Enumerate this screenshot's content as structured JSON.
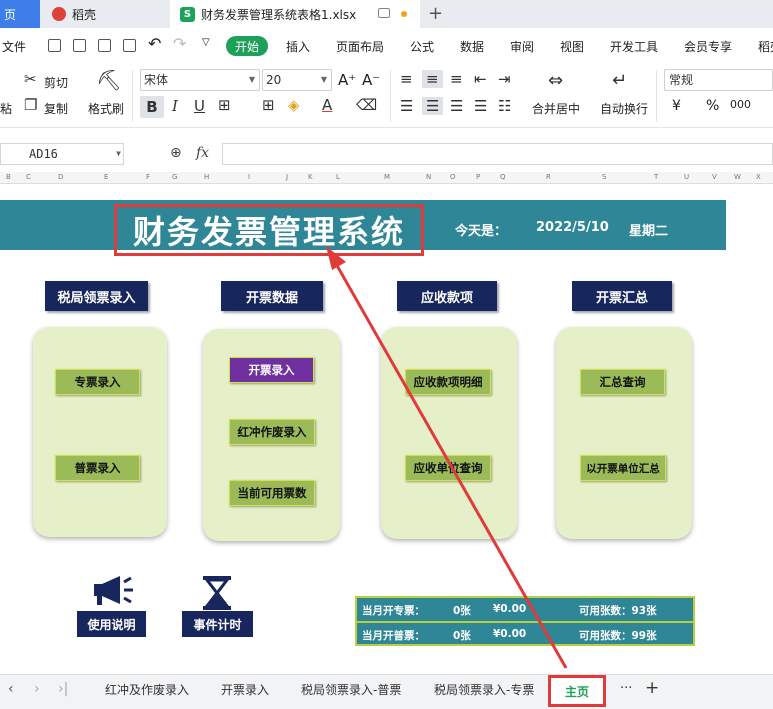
{
  "tabs": {
    "home": "页",
    "daoke": "稻壳",
    "doc": "财务发票管理系统表格1.xlsx",
    "doc_logo": "S"
  },
  "menu": {
    "file": "文件",
    "start": "开始",
    "items": [
      "插入",
      "页面布局",
      "公式",
      "数据",
      "审阅",
      "视图",
      "开发工具",
      "会员专享",
      "稻壳"
    ]
  },
  "ribbon": {
    "paste": "粘",
    "cut": "剪切",
    "copy": "复制",
    "format_painter": "格式刷",
    "font": "宋体",
    "size": "20",
    "grow": "A⁺",
    "shrink": "A⁻",
    "merge": "合并居中",
    "wrap": "自动换行",
    "number_format": "常规",
    "currency": "¥",
    "percent": "%",
    "thousands": "000"
  },
  "formula": {
    "cell": "AD16",
    "fx": "fx",
    "value": ""
  },
  "columns": [
    "B",
    "C",
    "D",
    "E",
    "F",
    "G",
    "H",
    "I",
    "J",
    "K",
    "L",
    "M",
    "N",
    "O",
    "P",
    "Q",
    "R",
    "S",
    "T",
    "U",
    "V",
    "W",
    "X"
  ],
  "sheet": {
    "title": "财务发票管理系统",
    "today_label": "今天是：",
    "date": "2022/5/10",
    "weekday": "星期二",
    "sections": [
      {
        "title": "税局领票录入",
        "buttons": [
          "专票录入",
          "普票录入"
        ]
      },
      {
        "title": "开票数据",
        "buttons": [
          "开票录入",
          "红冲作废录入",
          "当前可用票数"
        ]
      },
      {
        "title": "应收款项",
        "buttons": [
          "应收款项明细",
          "应收单位查询"
        ]
      },
      {
        "title": "开票汇总",
        "buttons": [
          "汇总查询",
          "以开票单位汇总"
        ]
      }
    ],
    "tiles": [
      "使用说明",
      "事件计时"
    ],
    "stats": [
      {
        "label": "当月开专票：",
        "count": "0张",
        "amount": "¥0.00",
        "available": "可用张数：93张"
      },
      {
        "label": "当月开普票：",
        "count": "0张",
        "amount": "¥0.00",
        "available": "可用张数：99张"
      }
    ]
  },
  "sheet_tabs": {
    "tabs": [
      "红冲及作废录入",
      "开票录入",
      "税局领票录入-普票",
      "税局领票录入-专票"
    ],
    "active": "主页",
    "more": "···",
    "add": "+"
  },
  "colors": {
    "banner": "#2f8696",
    "section_head": "#17265c",
    "panel": "#e5f0c8",
    "button": "#9bbb59",
    "button_active": "#7030a0",
    "highlight": "#e03a3a",
    "start_green": "#1ea05a"
  }
}
